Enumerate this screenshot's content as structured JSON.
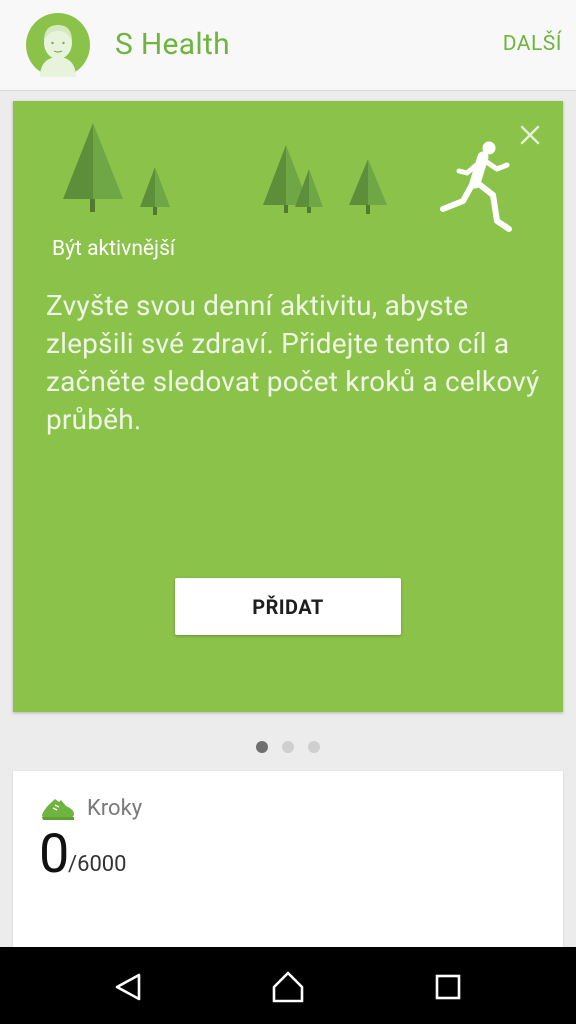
{
  "header": {
    "title": "S Health",
    "more_label": "DALŠÍ"
  },
  "promo_card": {
    "title": "Být aktivnější",
    "body": "Zvyšte svou denní aktivitu, abyste zlepšili své zdraví. Přidejte tento cíl a začněte sledovat počet kroků a celkový průběh.",
    "add_label": "PŘIDAT",
    "icons": [
      "tree-icon",
      "runner-icon",
      "close-icon"
    ]
  },
  "pager": {
    "count": 3,
    "active_index": 0
  },
  "steps_card": {
    "label": "Kroky",
    "value": "0",
    "goal": "/6000",
    "icon": "shoe-icon"
  },
  "navbar": {
    "icons": [
      "back-icon",
      "home-icon",
      "recents-icon"
    ]
  },
  "colors": {
    "accent": "#6fb43f",
    "card_green": "#8bc34a",
    "tree_dark": "#5d8e3a",
    "tree_light": "#6fa646"
  }
}
